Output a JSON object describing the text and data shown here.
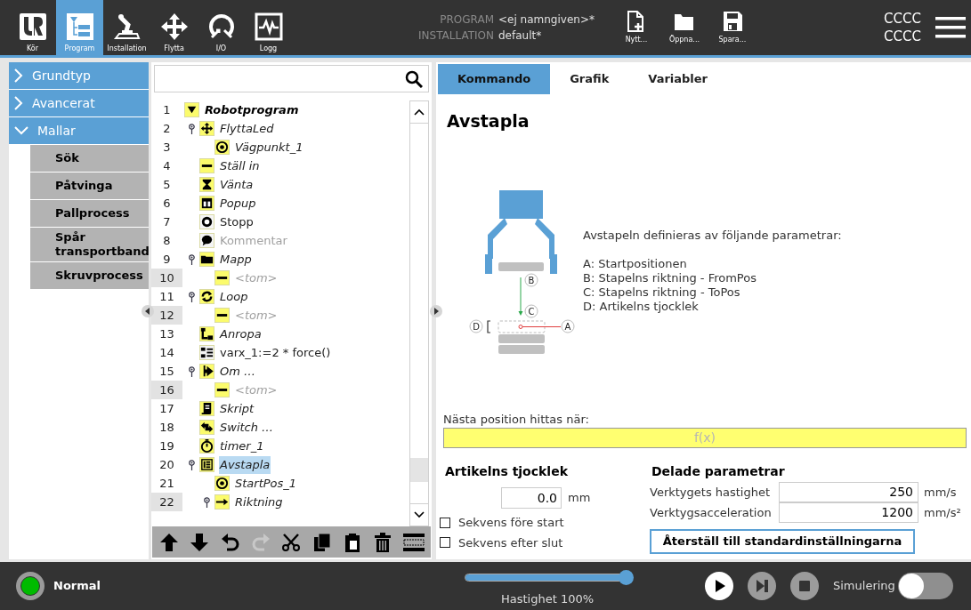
{
  "top_bar": {
    "nav": [
      {
        "label": "Kör",
        "kind": "logo",
        "selected": false
      },
      {
        "label": "Program",
        "kind": "program",
        "selected": true
      },
      {
        "label": "Installation",
        "kind": "robot",
        "selected": false
      },
      {
        "label": "Flytta",
        "kind": "move",
        "selected": false
      },
      {
        "label": "I/O",
        "kind": "io",
        "selected": false
      },
      {
        "label": "Logg",
        "kind": "log",
        "selected": false
      }
    ],
    "program_label": "PROGRAM",
    "program_name": "<ej namngiven>*",
    "installation_label": "INSTALLATION",
    "installation_name": "default*",
    "file_buttons": [
      {
        "label": "Nytt...",
        "kind": "new"
      },
      {
        "label": "Öppna...",
        "kind": "open"
      },
      {
        "label": "Spara...",
        "kind": "save"
      }
    ],
    "status_lines": [
      "CCCC",
      "CCCC"
    ]
  },
  "sidebar": {
    "groups": [
      {
        "label": "Grundtyp",
        "expanded": false
      },
      {
        "label": "Avancerat",
        "expanded": false
      },
      {
        "label": "Mallar",
        "expanded": true,
        "items": [
          "Sök",
          "Påtvinga",
          "Pallprocess",
          "Spår transportband",
          "Skruvprocess"
        ]
      }
    ]
  },
  "tree": {
    "root": {
      "number": "1",
      "label": "Robotprogram",
      "kind": "program",
      "children": [
        {
          "number": "2",
          "label": "FlyttaLed",
          "kind": "move",
          "italic": true,
          "dimmed": false,
          "marked": false,
          "selected": false,
          "expandable": true,
          "children": [
            {
              "number": "3",
              "label": "Vägpunkt_1",
              "kind": "waypoint",
              "italic": true,
              "dimmed": false,
              "marked": false,
              "selected": false,
              "expandable": false
            }
          ]
        },
        {
          "number": "4",
          "label": "Ställ in",
          "kind": "set",
          "italic": true,
          "dimmed": false,
          "marked": false,
          "selected": false,
          "expandable": false
        },
        {
          "number": "5",
          "label": "Vänta",
          "kind": "wait",
          "italic": true,
          "dimmed": false,
          "marked": false,
          "selected": false,
          "expandable": false
        },
        {
          "number": "6",
          "label": "Popup",
          "kind": "popup",
          "italic": true,
          "dimmed": false,
          "marked": false,
          "selected": false,
          "expandable": false
        },
        {
          "number": "7",
          "label": "Stopp",
          "kind": "stop",
          "italic": false,
          "dimmed": false,
          "marked": false,
          "selected": false,
          "expandable": false
        },
        {
          "number": "8",
          "label": "Kommentar",
          "kind": "comment",
          "italic": false,
          "dimmed": true,
          "marked": false,
          "selected": false,
          "expandable": false
        },
        {
          "number": "9",
          "label": "Mapp",
          "kind": "folder",
          "italic": true,
          "dimmed": false,
          "marked": false,
          "selected": false,
          "expandable": true,
          "children": [
            {
              "number": "10",
              "label": "<tom>",
              "kind": "set",
              "italic": true,
              "dimmed": true,
              "marked": true,
              "selected": false,
              "expandable": false
            }
          ]
        },
        {
          "number": "11",
          "label": "Loop",
          "kind": "loop",
          "italic": true,
          "dimmed": false,
          "marked": false,
          "selected": false,
          "expandable": true,
          "children": [
            {
              "number": "12",
              "label": "<tom>",
              "kind": "set",
              "italic": true,
              "dimmed": true,
              "marked": true,
              "selected": false,
              "expandable": false
            }
          ]
        },
        {
          "number": "13",
          "label": "Anropa",
          "kind": "call",
          "italic": true,
          "dimmed": false,
          "marked": false,
          "selected": false,
          "expandable": false
        },
        {
          "number": "14",
          "label": "varx_1:=2 * force()",
          "kind": "assign",
          "italic": false,
          "dimmed": false,
          "marked": false,
          "selected": false,
          "expandable": false
        },
        {
          "number": "15",
          "label": "Om …",
          "kind": "if",
          "italic": true,
          "dimmed": false,
          "marked": false,
          "selected": false,
          "expandable": true,
          "children": [
            {
              "number": "16",
              "label": "<tom>",
              "kind": "set",
              "italic": true,
              "dimmed": true,
              "marked": true,
              "selected": false,
              "expandable": false
            }
          ]
        },
        {
          "number": "17",
          "label": "Skript",
          "kind": "script",
          "italic": true,
          "dimmed": false,
          "marked": false,
          "selected": false,
          "expandable": false
        },
        {
          "number": "18",
          "label": "Switch …",
          "kind": "switch",
          "italic": true,
          "dimmed": false,
          "marked": false,
          "selected": false,
          "expandable": false
        },
        {
          "number": "19",
          "label": "timer_1",
          "kind": "timer",
          "italic": true,
          "dimmed": false,
          "marked": false,
          "selected": false,
          "expandable": false
        },
        {
          "number": "20",
          "label": "Avstapla",
          "kind": "pallet",
          "italic": true,
          "dimmed": false,
          "marked": false,
          "selected": true,
          "expandable": true,
          "children": [
            {
              "number": "21",
              "label": "StartPos_1",
              "kind": "waypoint",
              "italic": true,
              "dimmed": false,
              "marked": false,
              "selected": false,
              "expandable": false
            },
            {
              "number": "22",
              "label": "Riktning",
              "kind": "direction",
              "italic": true,
              "dimmed": false,
              "marked": true,
              "selected": false,
              "expandable": true
            }
          ]
        }
      ]
    }
  },
  "toolbar": [
    {
      "kind": "up",
      "disabled": false
    },
    {
      "kind": "down",
      "disabled": false
    },
    {
      "kind": "undo",
      "disabled": false
    },
    {
      "kind": "redo",
      "disabled": true
    },
    {
      "kind": "cut",
      "disabled": false
    },
    {
      "kind": "copy",
      "disabled": false
    },
    {
      "kind": "paste",
      "disabled": false
    },
    {
      "kind": "delete",
      "disabled": false
    },
    {
      "kind": "suppress",
      "disabled": false
    }
  ],
  "editor": {
    "tabs": [
      {
        "label": "Kommando",
        "selected": true
      },
      {
        "label": "Grafik",
        "selected": false
      },
      {
        "label": "Variabler",
        "selected": false
      }
    ],
    "title": "Avstapla",
    "diagram": {
      "markers": [
        "B",
        "C",
        "D",
        "A"
      ]
    },
    "description": {
      "intro": "Avstapeln definieras av följande parametrar:",
      "items": [
        "A: Startpositionen",
        "B: Stapelns riktning - FromPos",
        "C: Stapelns riktning - ToPos",
        "D: Artikelns tjocklek"
      ]
    },
    "condition": {
      "label": "Nästa position hittas när:",
      "placeholder": "f(x)"
    },
    "thickness": {
      "title": "Artikelns tjocklek",
      "value": "0.0",
      "unit": "mm"
    },
    "options": [
      {
        "label": "Sekvens före start",
        "checked": false
      },
      {
        "label": "Sekvens efter slut",
        "checked": false
      }
    ],
    "shared": {
      "title": "Delade parametrar",
      "rows": [
        {
          "label": "Verktygets hastighet",
          "value": "250",
          "unit": "mm/s"
        },
        {
          "label": "Verktygsacceleration",
          "value": "1200",
          "unit": "mm/s²"
        }
      ],
      "reset_button": "Återställ till standardinställningarna"
    }
  },
  "footer": {
    "status": "Normal",
    "speed": {
      "level": 1.0,
      "label": "Hastighet 100%"
    },
    "controls": [
      {
        "kind": "play",
        "disabled": false
      },
      {
        "kind": "step",
        "disabled": true
      },
      {
        "kind": "stop",
        "disabled": true
      }
    ],
    "simulation": {
      "label": "Simulering",
      "on": false
    }
  }
}
